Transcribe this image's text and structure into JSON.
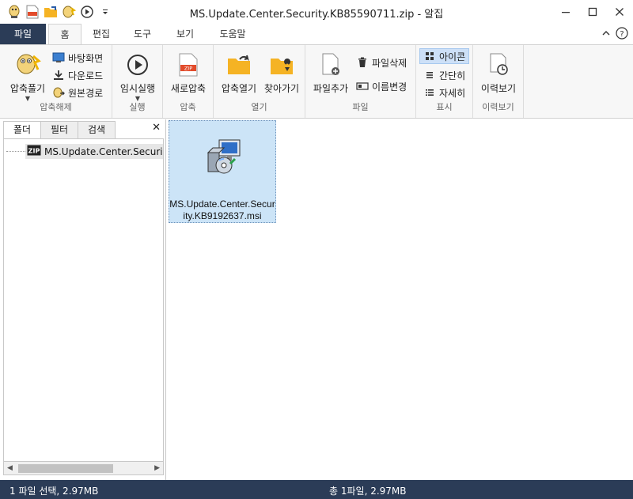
{
  "window": {
    "title": "MS.Update.Center.Security.KB85590711.zip - 알집"
  },
  "quick_access": [
    "app-logo-icon",
    "new-zip-icon",
    "open-folder-icon",
    "extract-icon",
    "run-icon",
    "customize-dropdown-icon"
  ],
  "tabs": {
    "file": "파일",
    "home": "홈",
    "edit": "편집",
    "tools": "도구",
    "view": "보기",
    "help": "도움말"
  },
  "ribbon": {
    "extract_group": {
      "label": "압축해제",
      "extract": "압축풀기",
      "desktop": "바탕화면",
      "download": "다운로드",
      "original_path": "원본경로"
    },
    "run_group": {
      "label": "실행",
      "temp_run": "임시실행"
    },
    "compress_group": {
      "label": "압축",
      "new_zip": "새로압축",
      "zip_badge": "ZIP"
    },
    "open_group": {
      "label": "열기",
      "open_archive": "압축열기",
      "find": "찾아가기"
    },
    "file_group": {
      "label": "파일",
      "add_file": "파일추가",
      "delete_file": "파일삭제",
      "rename": "이름변경"
    },
    "view_group": {
      "label": "표시",
      "icon": "아이콘",
      "simple": "간단히",
      "detail": "자세히"
    },
    "history_group": {
      "label": "이력보기",
      "history": "이력보기"
    }
  },
  "left_pane": {
    "tabs": [
      "폴더",
      "필터",
      "검색"
    ],
    "close": "✕",
    "tree_item": "MS.Update.Center.Security.K",
    "zip_badge": "ZIP"
  },
  "main_pane": {
    "file_name": "MS.Update.Center.Security.KB9192637.msi"
  },
  "status": {
    "left": "1 파일 선택,  2.97MB",
    "center": "총 1파일,  2.97MB"
  },
  "colors": {
    "accent_dark": "#2b3c57",
    "selection": "#cce4f7",
    "ribbon_bg": "#f7f7f7"
  }
}
